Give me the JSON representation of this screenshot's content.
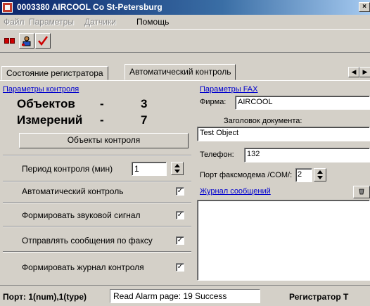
{
  "window": {
    "title": "0003380    AIRCOOL Co  St-Petersburg",
    "close_glyph": "×"
  },
  "menu": [
    {
      "label": "Файл",
      "enabled": false
    },
    {
      "label": "Параметры",
      "enabled": false
    },
    {
      "label": "Датчики",
      "enabled": false
    },
    {
      "label": "Помощь",
      "enabled": true
    }
  ],
  "toolbar": {
    "icons": [
      "stop-icon",
      "user-icon",
      "check-icon"
    ]
  },
  "tabs": [
    {
      "label": "Состояние регистратора",
      "active": false
    },
    {
      "label": "Автоматический контроль",
      "active": true
    }
  ],
  "left": {
    "section_link": "Параметры контроля",
    "objects_label": "Объектов",
    "objects_dash": "-",
    "objects_count": "3",
    "measurements_label": "Измерений",
    "measurements_dash": "-",
    "measurements_count": "7",
    "objects_button": "Объекты контроля",
    "period_label": "Период контроля (мин)",
    "period_value": "1",
    "checkboxes": [
      {
        "label": "Автоматический контроль",
        "checked": true,
        "mark": "✓"
      },
      {
        "label": "Формировать звуковой сигнал",
        "checked": true,
        "mark": "✓"
      },
      {
        "label": "Отправлять сообщения по факсу",
        "checked": true,
        "mark": "✓"
      },
      {
        "label": "Формировать журнал контроля",
        "checked": true,
        "mark": "✓"
      }
    ]
  },
  "right": {
    "fax_link": "Параметры FAX",
    "company_label": "Фирма:",
    "company_value": "AIRCOOL",
    "doc_header_label": "Заголовок документа:",
    "doc_header_value": "Test Object",
    "phone_label": "Телефон:",
    "phone_value": "132",
    "port_label": "Порт факсмодема /COM/:",
    "port_value": "2",
    "log_link": "Журнал сообщений"
  },
  "status": {
    "port": "Порт: 1(num),1(type)",
    "message": "Read Alarm page: 19 Success",
    "recorder": "Регистратор Т"
  }
}
